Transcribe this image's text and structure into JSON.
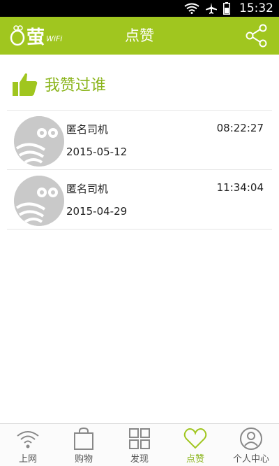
{
  "status_bar": {
    "time": "15:32",
    "icons": [
      "wifi-icon",
      "airplane-icon",
      "battery-icon"
    ]
  },
  "header": {
    "logo_text": "萤",
    "logo_sub": "WiFi",
    "title": "点赞",
    "share_icon": "share-icon"
  },
  "section": {
    "title": "我赞过谁",
    "icon": "thumbs-up-icon"
  },
  "likes": [
    {
      "name": "匿名司机",
      "time": "08:22:27",
      "date": "2015-05-12"
    },
    {
      "name": "匿名司机",
      "time": "11:34:04",
      "date": "2015-04-29"
    }
  ],
  "bottom_nav": {
    "items": [
      {
        "label": "上网",
        "icon": "wifi-icon"
      },
      {
        "label": "购物",
        "icon": "shopping-bag-icon"
      },
      {
        "label": "发现",
        "icon": "grid-icon"
      },
      {
        "label": "点赞",
        "icon": "heart-icon",
        "active": true
      },
      {
        "label": "个人中心",
        "icon": "user-icon"
      }
    ]
  },
  "colors": {
    "brand_green": "#a0c61f",
    "accent_text": "#8ab41a",
    "status_bar": "#000000"
  }
}
